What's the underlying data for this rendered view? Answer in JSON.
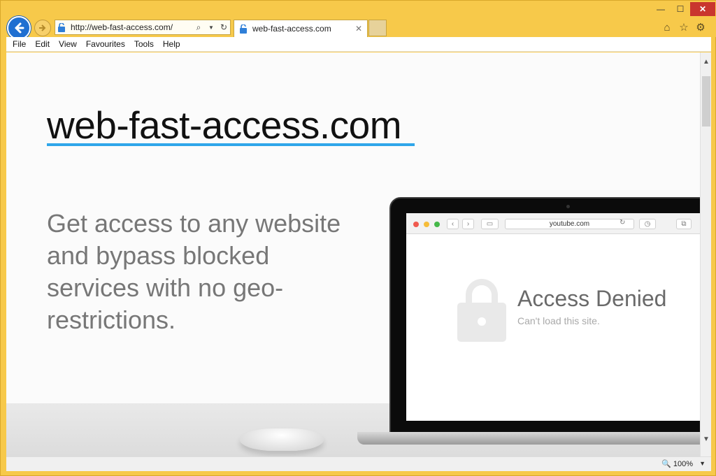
{
  "browser": {
    "address_url": "http://web-fast-access.com/",
    "tab_title": "web-fast-access.com",
    "zoom_level": "100%"
  },
  "menu": {
    "items": [
      "File",
      "Edit",
      "View",
      "Favourites",
      "Tools",
      "Help"
    ]
  },
  "page": {
    "title": "web-fast-access.com",
    "headline": "Get access to any website and bypass blocked services with no geo-restrictions."
  },
  "mockup": {
    "url": "youtube.com",
    "denied_title": "Access Denied",
    "denied_subtitle": "Can't load this site."
  },
  "colors": {
    "frame": "#f7c94a",
    "accent_underline": "#2fa6ea",
    "back_button": "#1f6fd1",
    "close_button": "#c9362e"
  },
  "icons": {
    "back": "arrow-left-icon",
    "forward": "arrow-right-icon",
    "lock": "lock-icon",
    "search": "search-icon",
    "refresh": "refresh-icon",
    "home": "home-icon",
    "favorites": "star-icon",
    "settings": "gear-icon",
    "zoom": "zoom-icon"
  }
}
